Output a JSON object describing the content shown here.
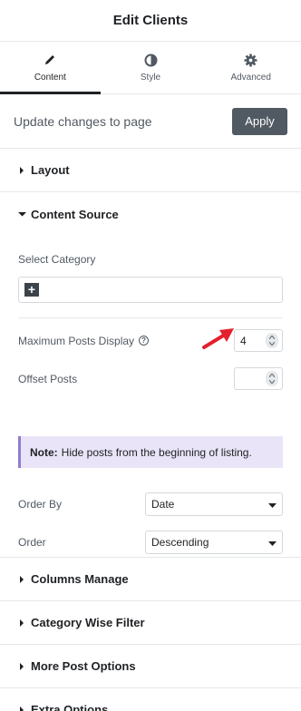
{
  "header": {
    "title": "Edit Clients"
  },
  "tabs": [
    {
      "label": "Content",
      "icon": "pencil-icon",
      "active": true
    },
    {
      "label": "Style",
      "icon": "contrast-icon",
      "active": false
    },
    {
      "label": "Advanced",
      "icon": "gear-icon",
      "active": false
    }
  ],
  "update_bar": {
    "text": "Update changes to page",
    "apply_label": "Apply"
  },
  "sections": {
    "layout": "Layout",
    "content_source": "Content Source",
    "columns_manage": "Columns Manage",
    "category_wise_filter": "Category Wise Filter",
    "more_post_options": "More Post Options",
    "extra_options": "Extra Options"
  },
  "content_source": {
    "select_category_label": "Select Category",
    "max_posts_label": "Maximum Posts Display",
    "max_posts_value": "4",
    "offset_label": "Offset Posts",
    "offset_value": "",
    "note_label": "Note:",
    "note_text": "Hide posts from the beginning of listing.",
    "order_by_label": "Order By",
    "order_by_value": "Date",
    "order_label": "Order",
    "order_value": "Descending"
  },
  "colors": {
    "accent_note_border": "#8f7bd0",
    "note_bg": "#e9e4f7",
    "apply_bg": "#515962",
    "arrow": "#e3202e"
  }
}
